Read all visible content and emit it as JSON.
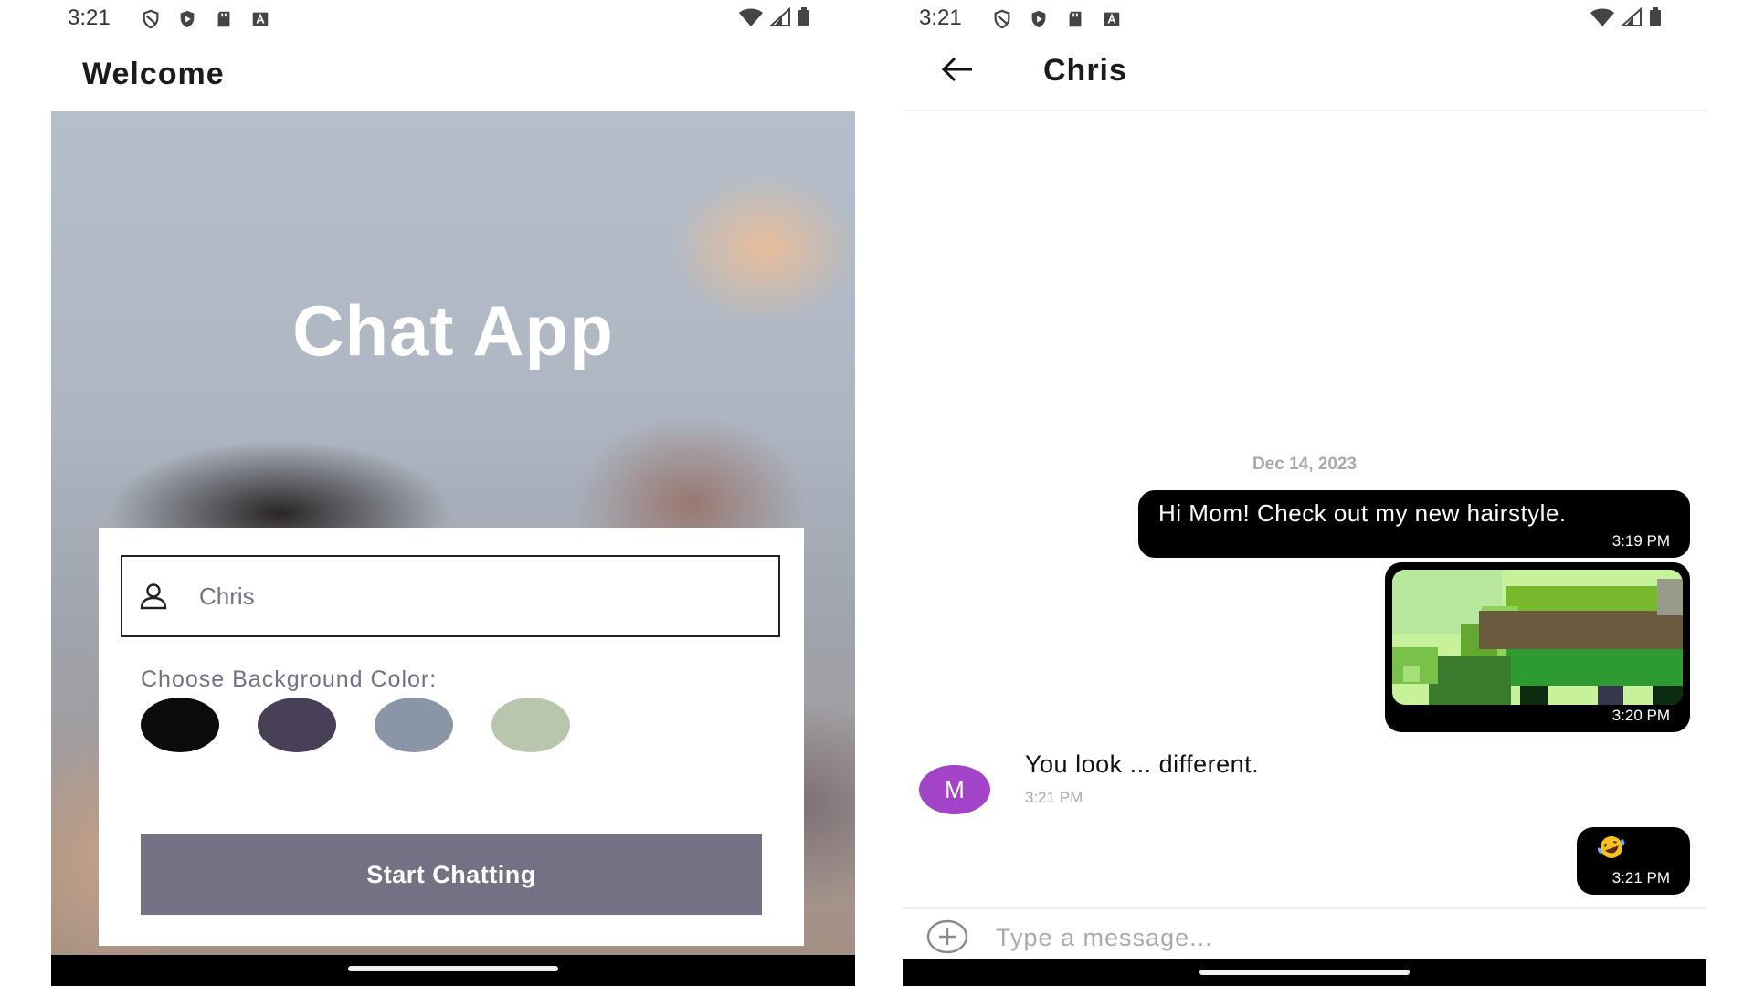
{
  "left_screen": {
    "status_bar": {
      "time": "3:21"
    },
    "app_bar": {
      "title": "Welcome"
    },
    "hero_title": "Chat App",
    "login": {
      "name_value": "Chris",
      "choose_label": "Choose Background Color:",
      "colors": [
        "#090C08",
        "#474056",
        "#8A95A5",
        "#B9C6AE"
      ],
      "start_button": "Start Chatting"
    }
  },
  "right_screen": {
    "status_bar": {
      "time": "3:21"
    },
    "app_bar": {
      "title": "Chris"
    },
    "date_separator": "Dec 14, 2023",
    "messages": [
      {
        "text": "Hi Mom! Check out my new hairstyle.",
        "time": "3:19 PM"
      },
      {
        "image": "photo",
        "time": "3:20 PM"
      },
      {
        "sender_initial": "M",
        "text": "You look ... different.",
        "time": "3:21 PM"
      },
      {
        "emoji": "rolling-on-floor-laughing-emoji",
        "time": "3:21 PM"
      }
    ],
    "input": {
      "placeholder": "Type a message..."
    }
  }
}
